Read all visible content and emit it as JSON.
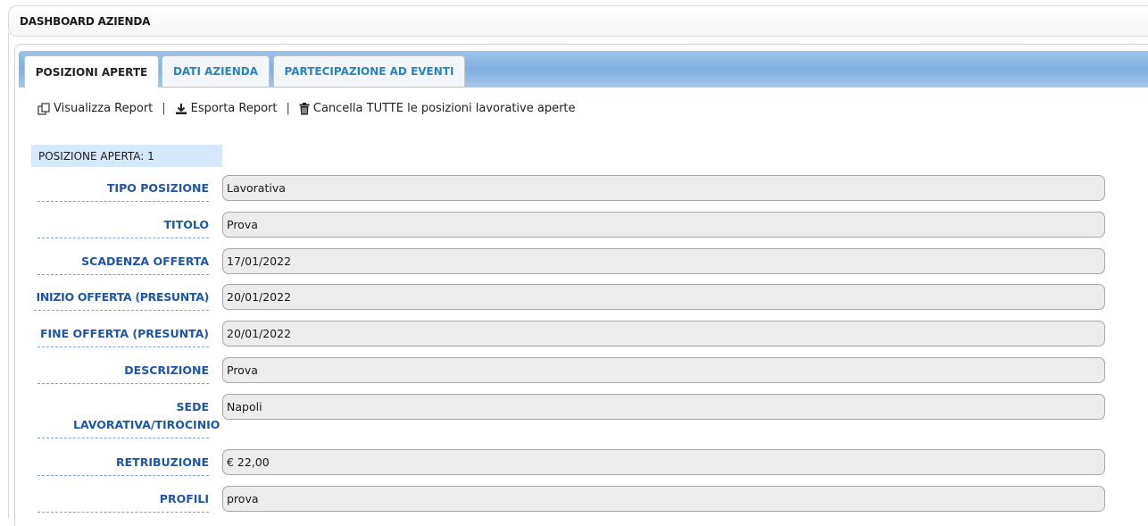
{
  "header": {
    "title": "DASHBOARD AZIENDA"
  },
  "tabs": [
    {
      "label": "POSIZIONI APERTE",
      "active": true
    },
    {
      "label": "DATI AZIENDA",
      "active": false
    },
    {
      "label": "PARTECIPAZIONE AD EVENTI",
      "active": false
    }
  ],
  "toolbar": {
    "view_report": "Visualizza Report",
    "export_report": "Esporta Report",
    "delete_all": "Cancella TUTTE le posizioni lavorative aperte",
    "separator": "|"
  },
  "position": {
    "header": "POSIZIONE APERTA: 1",
    "fields": [
      {
        "label": "TIPO POSIZIONE",
        "value": "Lavorativa"
      },
      {
        "label": "TITOLO",
        "value": "Prova"
      },
      {
        "label": "SCADENZA OFFERTA",
        "value": "17/01/2022"
      },
      {
        "label": "INIZIO OFFERTA (PRESUNTA)",
        "value": "20/01/2022"
      },
      {
        "label": "FINE OFFERTA (PRESUNTA)",
        "value": "20/01/2022"
      },
      {
        "label": "DESCRIZIONE",
        "value": "Prova"
      },
      {
        "label": "SEDE LAVORATIVA/TIROCINIO",
        "value": "Napoli"
      },
      {
        "label": "RETRIBUZIONE",
        "value": "€ 22,00"
      },
      {
        "label": "PROFILI",
        "value": "prova"
      }
    ]
  },
  "colors": {
    "tabbar": "#8fb9e6",
    "label_text": "#1f57a6",
    "tab_link": "#2a83c4",
    "position_header_bg": "#d6e8fb"
  }
}
